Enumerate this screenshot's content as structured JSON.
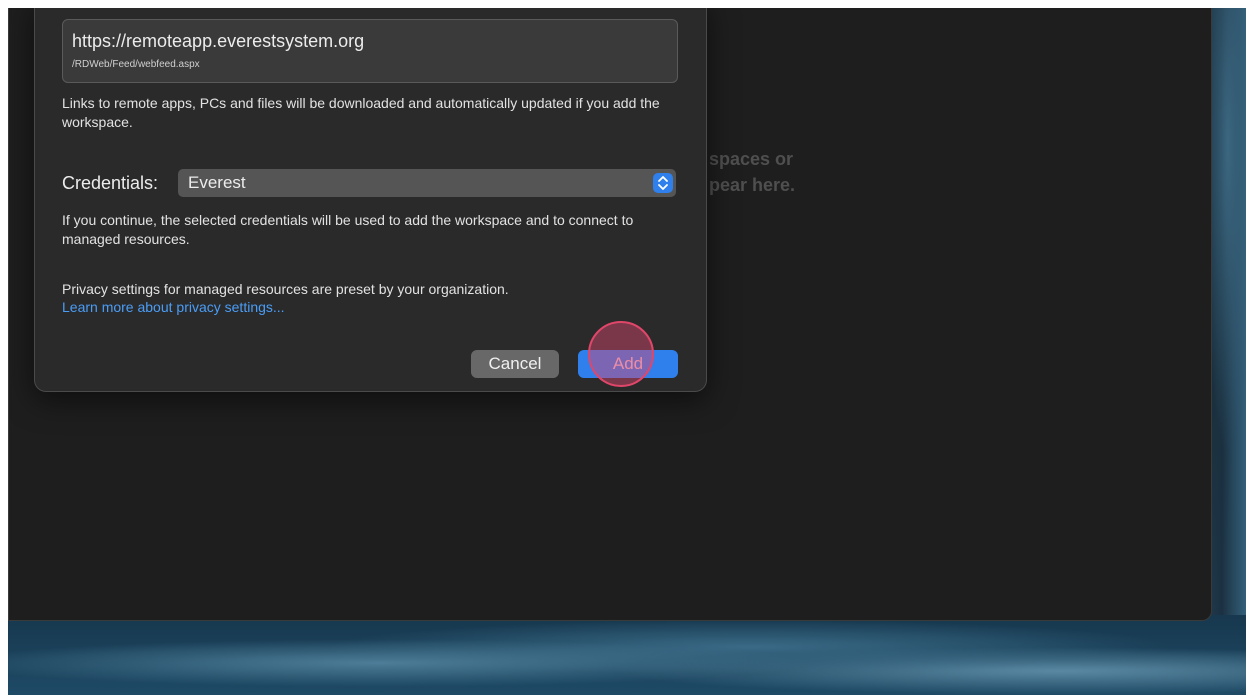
{
  "background": {
    "empty_state_lines": [
      "spaces or",
      "pear here."
    ]
  },
  "dialog": {
    "url_main": "https://remoteapp.everestsystem.org",
    "url_path": "/RDWeb/Feed/webfeed.aspx",
    "feed_description": "Links to remote apps, PCs and files will be downloaded and automatically updated if you add the workspace.",
    "credentials_label": "Credentials:",
    "credentials_value": "Everest",
    "credentials_description": "If you continue, the selected credentials will be used to add the workspace and to connect to managed resources.",
    "privacy_text": "Privacy settings for managed resources are preset by your organization.",
    "privacy_link": "Learn more about privacy settings...",
    "cancel_label": "Cancel",
    "add_label": "Add"
  },
  "colors": {
    "accent": "#2f80ed",
    "link": "#4a9df7",
    "click_marker": "#e0466a"
  },
  "icons": {
    "select_arrows": "up-down-chevron-icon"
  }
}
